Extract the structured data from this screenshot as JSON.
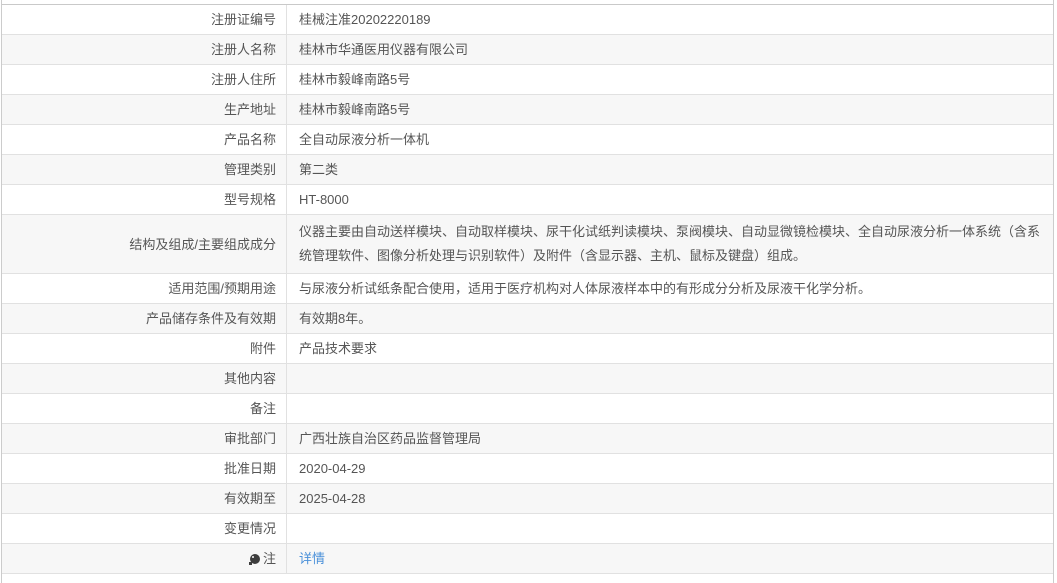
{
  "colors": {
    "link": "#4a90d9",
    "row_alt_background": "#f7f7f7",
    "border": "#e1e1e1",
    "text": "#555555"
  },
  "table": {
    "rows": [
      {
        "label": "注册证编号",
        "value": "桂械注准20202220189",
        "type": "text"
      },
      {
        "label": "注册人名称",
        "value": "桂林市华通医用仪器有限公司",
        "type": "text"
      },
      {
        "label": "注册人住所",
        "value": "桂林市毅峰南路5号",
        "type": "text"
      },
      {
        "label": "生产地址",
        "value": "桂林市毅峰南路5号",
        "type": "text"
      },
      {
        "label": "产品名称",
        "value": "全自动尿液分析一体机",
        "type": "text"
      },
      {
        "label": "管理类别",
        "value": "第二类",
        "type": "text"
      },
      {
        "label": "型号规格",
        "value": "HT-8000",
        "type": "text"
      },
      {
        "label": "结构及组成/主要组成成分",
        "value": "仪器主要由自动送样模块、自动取样模块、尿干化试纸判读模块、泵阀模块、自动显微镜检模块、全自动尿液分析一体系统（含系统管理软件、图像分析处理与识别软件）及附件（含显示器、主机、鼠标及键盘）组成。",
        "type": "text",
        "tall": true
      },
      {
        "label": "适用范围/预期用途",
        "value": "与尿液分析试纸条配合使用，适用于医疗机构对人体尿液样本中的有形成分分析及尿液干化学分析。",
        "type": "text"
      },
      {
        "label": "产品储存条件及有效期",
        "value": "有效期8年。",
        "type": "text"
      },
      {
        "label": "附件",
        "value": "产品技术要求",
        "type": "text"
      },
      {
        "label": "其他内容",
        "value": "",
        "type": "text"
      },
      {
        "label": "备注",
        "value": "",
        "type": "text"
      },
      {
        "label": "审批部门",
        "value": "广西壮族自治区药品监督管理局",
        "type": "text"
      },
      {
        "label": "批准日期",
        "value": "2020-04-29",
        "type": "text"
      },
      {
        "label": "有效期至",
        "value": "2025-04-28",
        "type": "text"
      },
      {
        "label": "变更情况",
        "value": "",
        "type": "text"
      },
      {
        "label": "注",
        "value": "详情",
        "type": "link",
        "icon": "note-bullet-icon"
      }
    ]
  }
}
